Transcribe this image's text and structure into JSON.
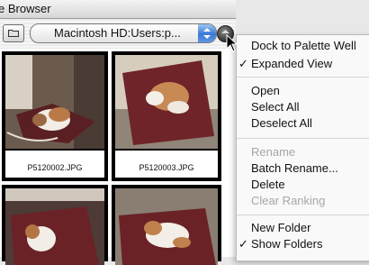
{
  "window": {
    "title": "e Browser"
  },
  "toolbar": {
    "path_value": "Macintosh HD:Users:p..."
  },
  "thumbnails": [
    {
      "filename": "P5120002.JPG"
    },
    {
      "filename": "P5120003.JPG"
    },
    {
      "filename": ""
    },
    {
      "filename": ""
    }
  ],
  "menu": {
    "items": [
      {
        "label": "Dock to Palette Well",
        "checked": false,
        "enabled": true
      },
      {
        "label": "Expanded View",
        "checked": true,
        "enabled": true
      },
      {
        "label": "Open",
        "checked": false,
        "enabled": true
      },
      {
        "label": "Select All",
        "checked": false,
        "enabled": true
      },
      {
        "label": "Deselect All",
        "checked": false,
        "enabled": true
      },
      {
        "label": "Rename",
        "checked": false,
        "enabled": false
      },
      {
        "label": "Batch Rename...",
        "checked": false,
        "enabled": true
      },
      {
        "label": "Delete",
        "checked": false,
        "enabled": true
      },
      {
        "label": "Clear Ranking",
        "checked": false,
        "enabled": false
      },
      {
        "label": "New Folder",
        "checked": false,
        "enabled": true
      },
      {
        "label": "Show Folders",
        "checked": true,
        "enabled": true
      }
    ],
    "check_glyph": "✓"
  },
  "colors": {
    "accent": "#3a78d4",
    "disabled_text": "#a6a6a6"
  }
}
